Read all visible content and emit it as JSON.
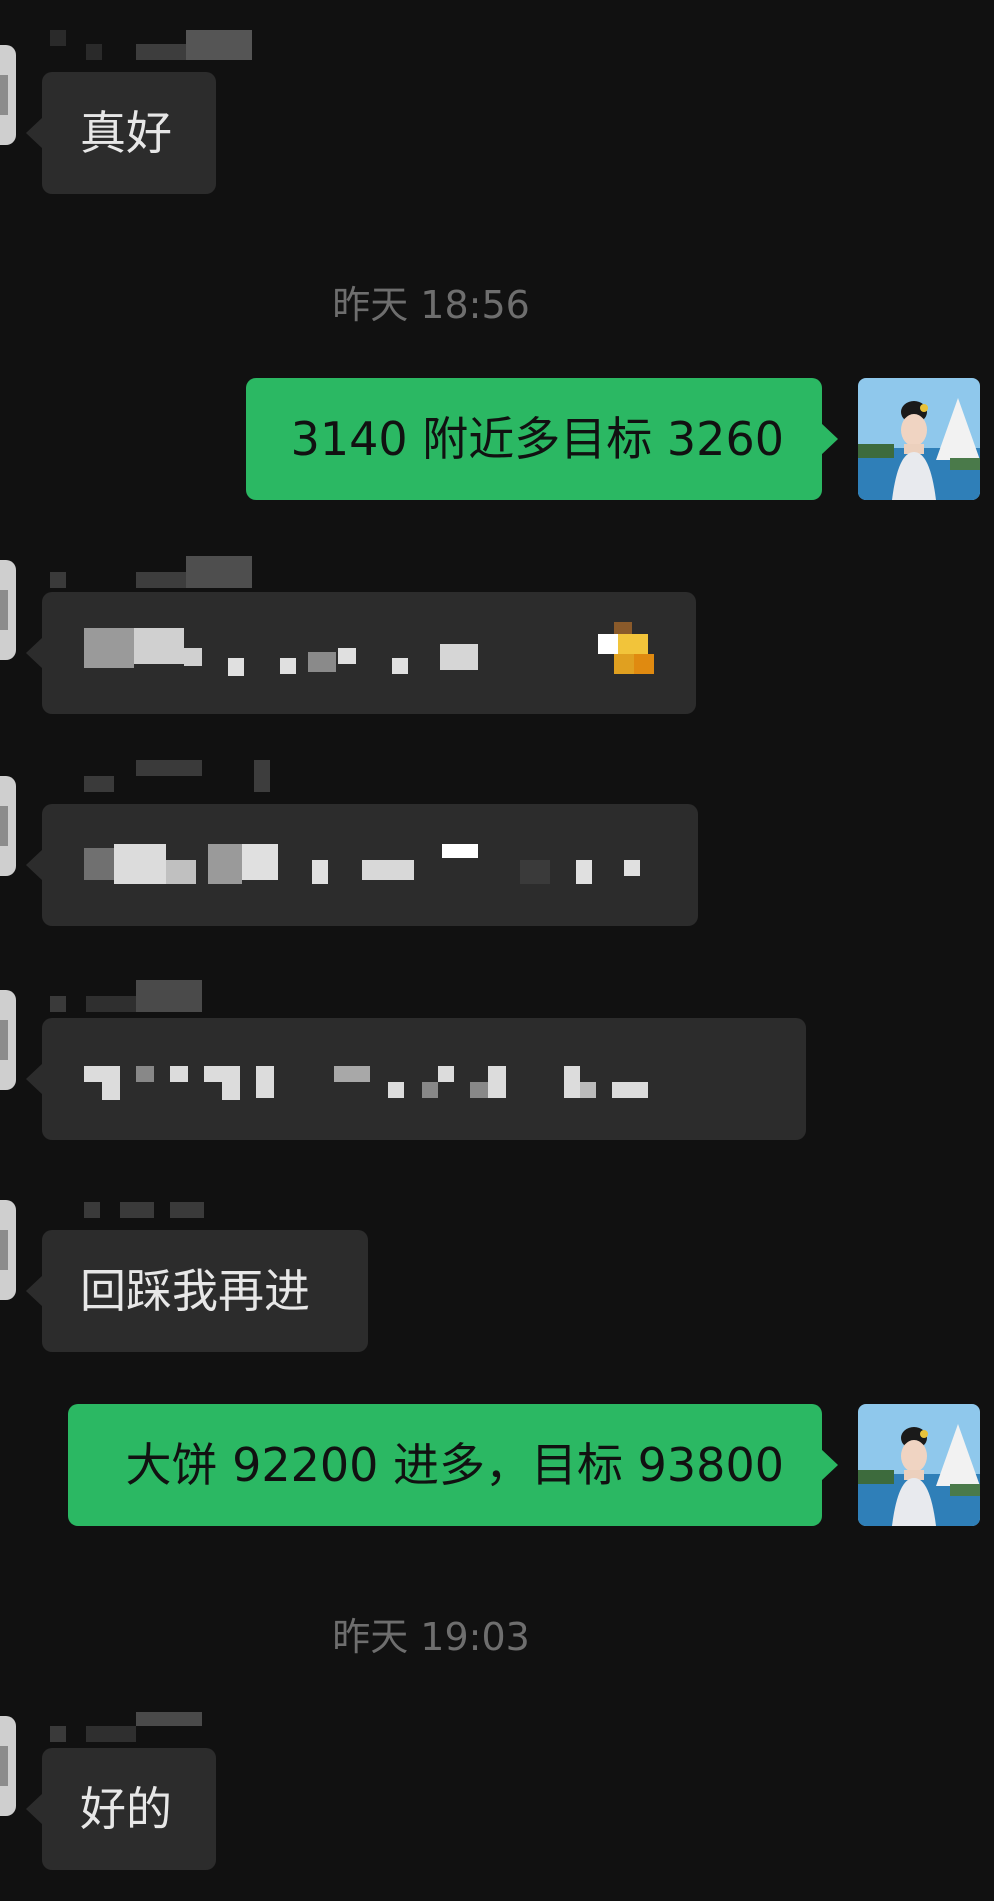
{
  "timestamps": [
    "昨天 18:56",
    "昨天 19:03"
  ],
  "messages": {
    "m1": "真好",
    "m2": "3140 附近多目标 3260",
    "m6": "回踩我再进",
    "m7": "大饼 92200 进多，目标 93800",
    "m8": "好的"
  },
  "colors": {
    "background": "#111111",
    "incoming_bubble": "#2c2c2c",
    "outgoing_bubble": "#2bb863",
    "timestamp_text": "#6e6e6e"
  },
  "icons": [
    "user-avatar-icon",
    "contact-avatar-icon"
  ]
}
